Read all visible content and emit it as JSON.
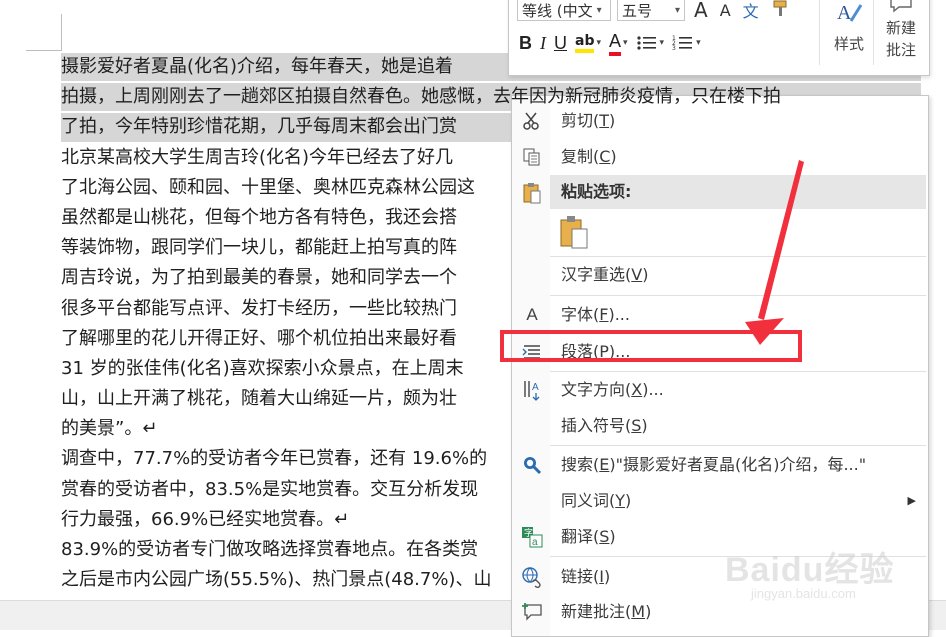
{
  "document": {
    "lines": [
      {
        "text": "摄影爱好者夏晶(化名)介绍，每年春天，她是追着",
        "selected": true
      },
      {
        "text": "拍摄，上周刚刚去了一趟郊区拍摄自然春色。她感慨，去年因为新冠肺炎疫情，只在楼下拍",
        "selected": true
      },
      {
        "text": "了拍，今年特别珍惜花期，几乎每周末都会出门赏",
        "selected": true
      },
      {
        "text": "北京某高校大学生周吉玲(化名)今年已经去了好几",
        "selected": false
      },
      {
        "text": "了北海公园、颐和园、十里堡、奥林匹克森林公园这",
        "selected": false
      },
      {
        "text": "虽然都是山桃花，但每个地方各有特色，我还会搭",
        "selected": false
      },
      {
        "text": "等装饰物，跟同学们一块儿，都能赶上拍写真的阵",
        "selected": false
      },
      {
        "text": "周吉玲说，为了拍到最美的春景，她和同学去一个",
        "selected": false
      },
      {
        "text": "很多平台都能写点评、发打卡经历，一些比较热门",
        "selected": false
      },
      {
        "text": "了解哪里的花儿开得正好、哪个机位拍出来最好看",
        "selected": false
      },
      {
        "text": "31 岁的张佳伟(化名)喜欢探索小众景点，在上周末",
        "selected": false
      },
      {
        "text": "山，山上开满了桃花，随着大山绵延一片，颇为壮",
        "selected": false
      },
      {
        "text": "的美景”。↵",
        "selected": false
      },
      {
        "text": "调查中，77.7%的受访者今年已赏春，还有 19.6%的",
        "selected": false
      },
      {
        "text": "赏春的受访者中，83.5%是实地赏春。交互分析发现",
        "selected": false
      },
      {
        "text": "行力最强，66.9%已经实地赏春。↵",
        "selected": false
      },
      {
        "text": "83.9%的受访者专门做攻略选择赏春地点。在各类赏",
        "selected": false
      },
      {
        "text": "之后是市内公园广场(55.5%)、热门景点(48.7%)、山",
        "selected": false
      }
    ]
  },
  "mini_toolbar": {
    "font_name": "等线 (中文",
    "font_size": "五号",
    "grow_font": "A",
    "shrink_font": "A",
    "phonetic": "文",
    "bold": "B",
    "italic": "I",
    "underline": "U",
    "highlight": "ab",
    "font_color": "A",
    "styles_label": "样式",
    "new_comment_label_1": "新建",
    "new_comment_label_2": "批注",
    "highlight_color": "#ffe600",
    "font_color_value": "#e81123"
  },
  "context_menu": {
    "cut": {
      "label": "剪切(",
      "key": "T",
      "end": ")"
    },
    "copy": {
      "label": "复制(",
      "key": "C",
      "end": ")"
    },
    "paste_options": "粘贴选项:",
    "reconvert": {
      "label": "汉字重选(",
      "key": "V",
      "end": ")"
    },
    "font": {
      "label": "字体(",
      "key": "F",
      "end": ")..."
    },
    "paragraph": {
      "label": "段落(",
      "key": "P",
      "end": ")..."
    },
    "text_direction": {
      "label": "文字方向(",
      "key": "X",
      "end": ")..."
    },
    "insert_symbol": {
      "label": "插入符号(",
      "key": "S",
      "end": ")"
    },
    "search": {
      "label": "搜索(",
      "key": "E",
      "end": ")\"摄影爱好者夏晶(化名)介绍，每...\""
    },
    "synonyms": {
      "label": "同义词(",
      "key": "Y",
      "end": ")"
    },
    "translate": {
      "label": "翻译(",
      "key": "S",
      "end": ")"
    },
    "link": {
      "label": "链接(",
      "key": "I",
      "end": ")"
    },
    "new_comment": {
      "label": "新建批注(",
      "key": "M",
      "end": ")"
    }
  },
  "annotation": {
    "color": "#f22f3d"
  },
  "watermark": {
    "text": "Baidu经验",
    "sub": "jingyan.baidu.com"
  }
}
